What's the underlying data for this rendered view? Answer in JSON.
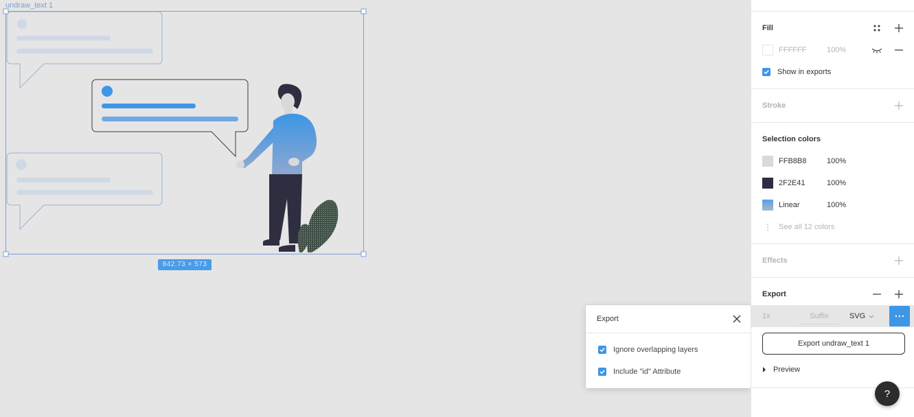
{
  "canvas": {
    "frame_name": "undraw_text 1",
    "dimensions_label": "842.73 × 573"
  },
  "popup": {
    "title": "Export",
    "options": [
      {
        "label": "Ignore overlapping layers",
        "checked": true
      },
      {
        "label": "Include \"id\" Attribute",
        "checked": true
      }
    ]
  },
  "panel": {
    "fill": {
      "title": "Fill",
      "color_hex": "FFFFFF",
      "opacity": "100%",
      "show_in_exports_label": "Show in exports"
    },
    "stroke": {
      "title": "Stroke"
    },
    "selection_colors": {
      "title": "Selection colors",
      "items": [
        {
          "hex": "FFB8B8",
          "opacity": "100%",
          "swatch": "#d9d9d9"
        },
        {
          "hex": "2F2E41",
          "opacity": "100%",
          "swatch": "#2f2e41"
        },
        {
          "hex": "Linear",
          "opacity": "100%",
          "swatch": "#6ea3e0"
        }
      ],
      "see_all_label": "See all 12 colors"
    },
    "effects": {
      "title": "Effects"
    },
    "export": {
      "title": "Export",
      "scale": "1x",
      "suffix_placeholder": "Suffix",
      "format": "SVG",
      "export_button_label": "Export undraw_text 1",
      "preview_label": "Preview"
    },
    "help_label": "?"
  },
  "colors": {
    "accent": "#3d96e6",
    "selection_outline": "#7aa0d6",
    "bubble_border": "#9bb3cf",
    "dark_figure": "#2f2e41"
  }
}
